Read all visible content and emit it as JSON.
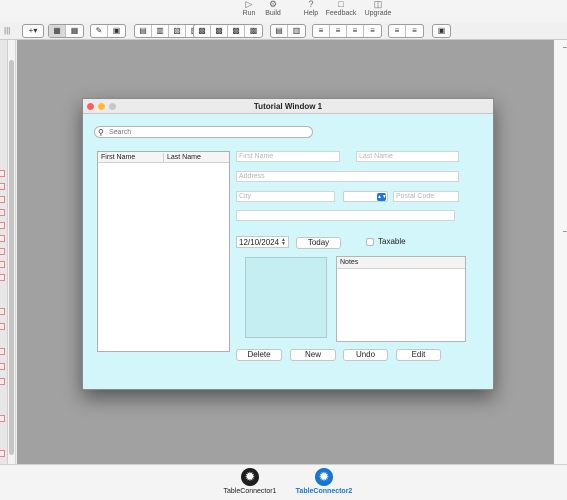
{
  "top_toolbar": {
    "buttons": [
      {
        "label": "Run",
        "icon": "play-icon"
      },
      {
        "label": "Build",
        "icon": "build-icon"
      },
      {
        "label": "Help",
        "icon": "help-icon"
      },
      {
        "label": "Feedback",
        "icon": "feedback-icon"
      },
      {
        "label": "Upgrade",
        "icon": "cart-icon"
      }
    ]
  },
  "design_window": {
    "title": "Tutorial Window 1",
    "search": {
      "placeholder": "Search",
      "value": ""
    },
    "list": {
      "columns": [
        "First Name",
        "Last Name"
      ],
      "rows": []
    },
    "fields": {
      "first_name": {
        "placeholder": "First Name",
        "value": ""
      },
      "last_name": {
        "placeholder": "Last Name",
        "value": ""
      },
      "address": {
        "placeholder": "Address",
        "value": ""
      },
      "city": {
        "placeholder": "City",
        "value": ""
      },
      "postal_code": {
        "placeholder": "Postal Code",
        "value": ""
      },
      "extra": {
        "placeholder": "",
        "value": ""
      }
    },
    "date": {
      "value": "12/10/2024",
      "today_label": "Today"
    },
    "taxable": {
      "label": "Taxable",
      "checked": false
    },
    "notes": {
      "header": "Notes"
    },
    "actions": {
      "delete": "Delete",
      "new": "New",
      "undo": "Undo",
      "edit": "Edit"
    }
  },
  "tray": {
    "items": [
      {
        "label": "TableConnector1",
        "selected": false
      },
      {
        "label": "TableConnector2",
        "selected": true
      }
    ]
  },
  "colors": {
    "window_background": "#d3f6fb",
    "image_well": "#c5eef3",
    "accent": "#1775d8",
    "canvas": "#a1a1a1"
  }
}
